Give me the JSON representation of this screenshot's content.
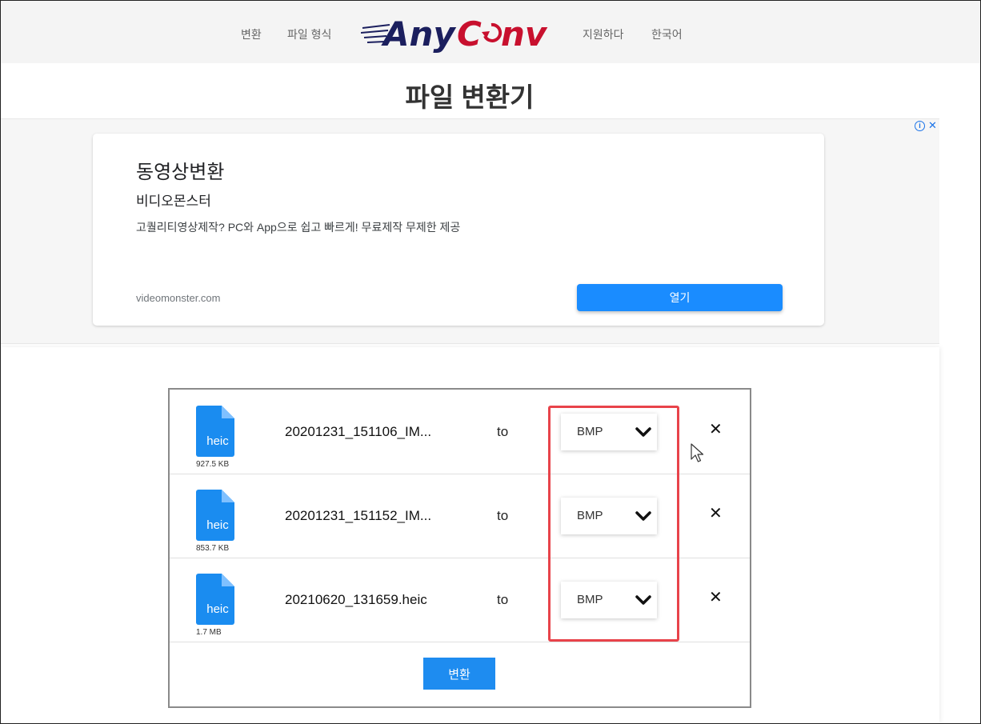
{
  "nav": {
    "convert": "변환",
    "formats": "파일 형식",
    "support": "지원하다",
    "language": "한국어",
    "logo_part1": "Any",
    "logo_part2": "Conv",
    "logo_c": "C",
    "logo_rest": "nv"
  },
  "page": {
    "title": "파일 변환기"
  },
  "ad": {
    "headline": "동영상변환",
    "advertiser": "비디오몬스터",
    "body": "고퀄리티영상제작? PC와 App으로 쉽고 빠르게! 무료제작 무제한 제공",
    "url": "videomonster.com",
    "open_label": "열기"
  },
  "files": [
    {
      "ext": "heic",
      "name": "20201231_151106_IM...",
      "size": "927.5 KB",
      "to": "to",
      "format": "BMP"
    },
    {
      "ext": "heic",
      "name": "20201231_151152_IM...",
      "size": "853.7 KB",
      "to": "to",
      "format": "BMP"
    },
    {
      "ext": "heic",
      "name": "20210620_131659.heic",
      "size": "1.7 MB",
      "to": "to",
      "format": "BMP"
    }
  ],
  "convert_button": "변환",
  "colors": {
    "accent": "#1e8cf0",
    "file_icon": "#1a8cf0",
    "highlight": "#e8434a",
    "logo_navy": "#1b1f5e",
    "logo_red": "#c8102e"
  }
}
